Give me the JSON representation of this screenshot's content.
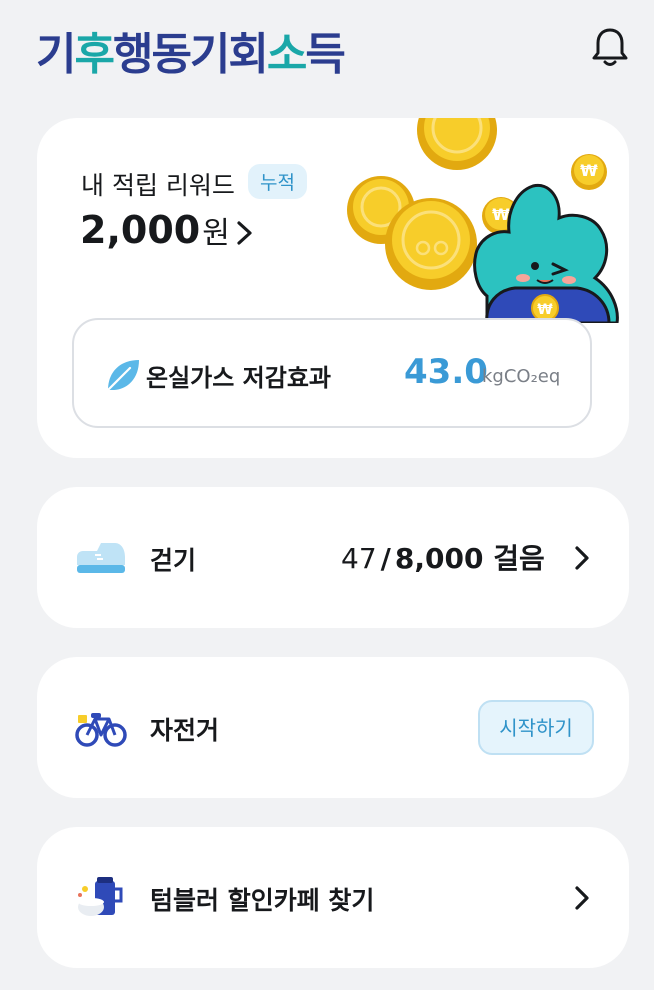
{
  "header": {
    "logo_text": "기후행동기회소득",
    "logo_parts": [
      "기",
      "후",
      "행동기회",
      "소",
      "득"
    ]
  },
  "reward": {
    "label": "내 적립 리워드",
    "badge": "누적",
    "amount": "2,000",
    "unit": "원"
  },
  "ghg": {
    "label": "온실가스 저감효과",
    "value": "43.0",
    "unit": "kgCO₂eq"
  },
  "walking": {
    "label": "걷기",
    "current_steps": "47",
    "separator": "/",
    "goal": "8,000 걸음"
  },
  "bicycle": {
    "label": "자전거",
    "start_button": "시작하기"
  },
  "tumbler": {
    "label": "텀블러 할인카페 찾기"
  },
  "colors": {
    "background": "#f1f2f4",
    "card": "#ffffff",
    "brand_navy": "#2b3d8f",
    "brand_teal": "#1aa7a8",
    "accent_blue": "#3a9ad6",
    "coin_gold": "#f4c21e",
    "mascot_teal": "#2cc2c0"
  },
  "icons": {
    "bell": "bell-icon",
    "reward_chevron": "chevron-right-icon",
    "leaf": "leaf-icon",
    "shoe": "sneaker-icon",
    "bicycle": "bicycle-icon",
    "tumbler": "tumbler-cup-icon"
  }
}
